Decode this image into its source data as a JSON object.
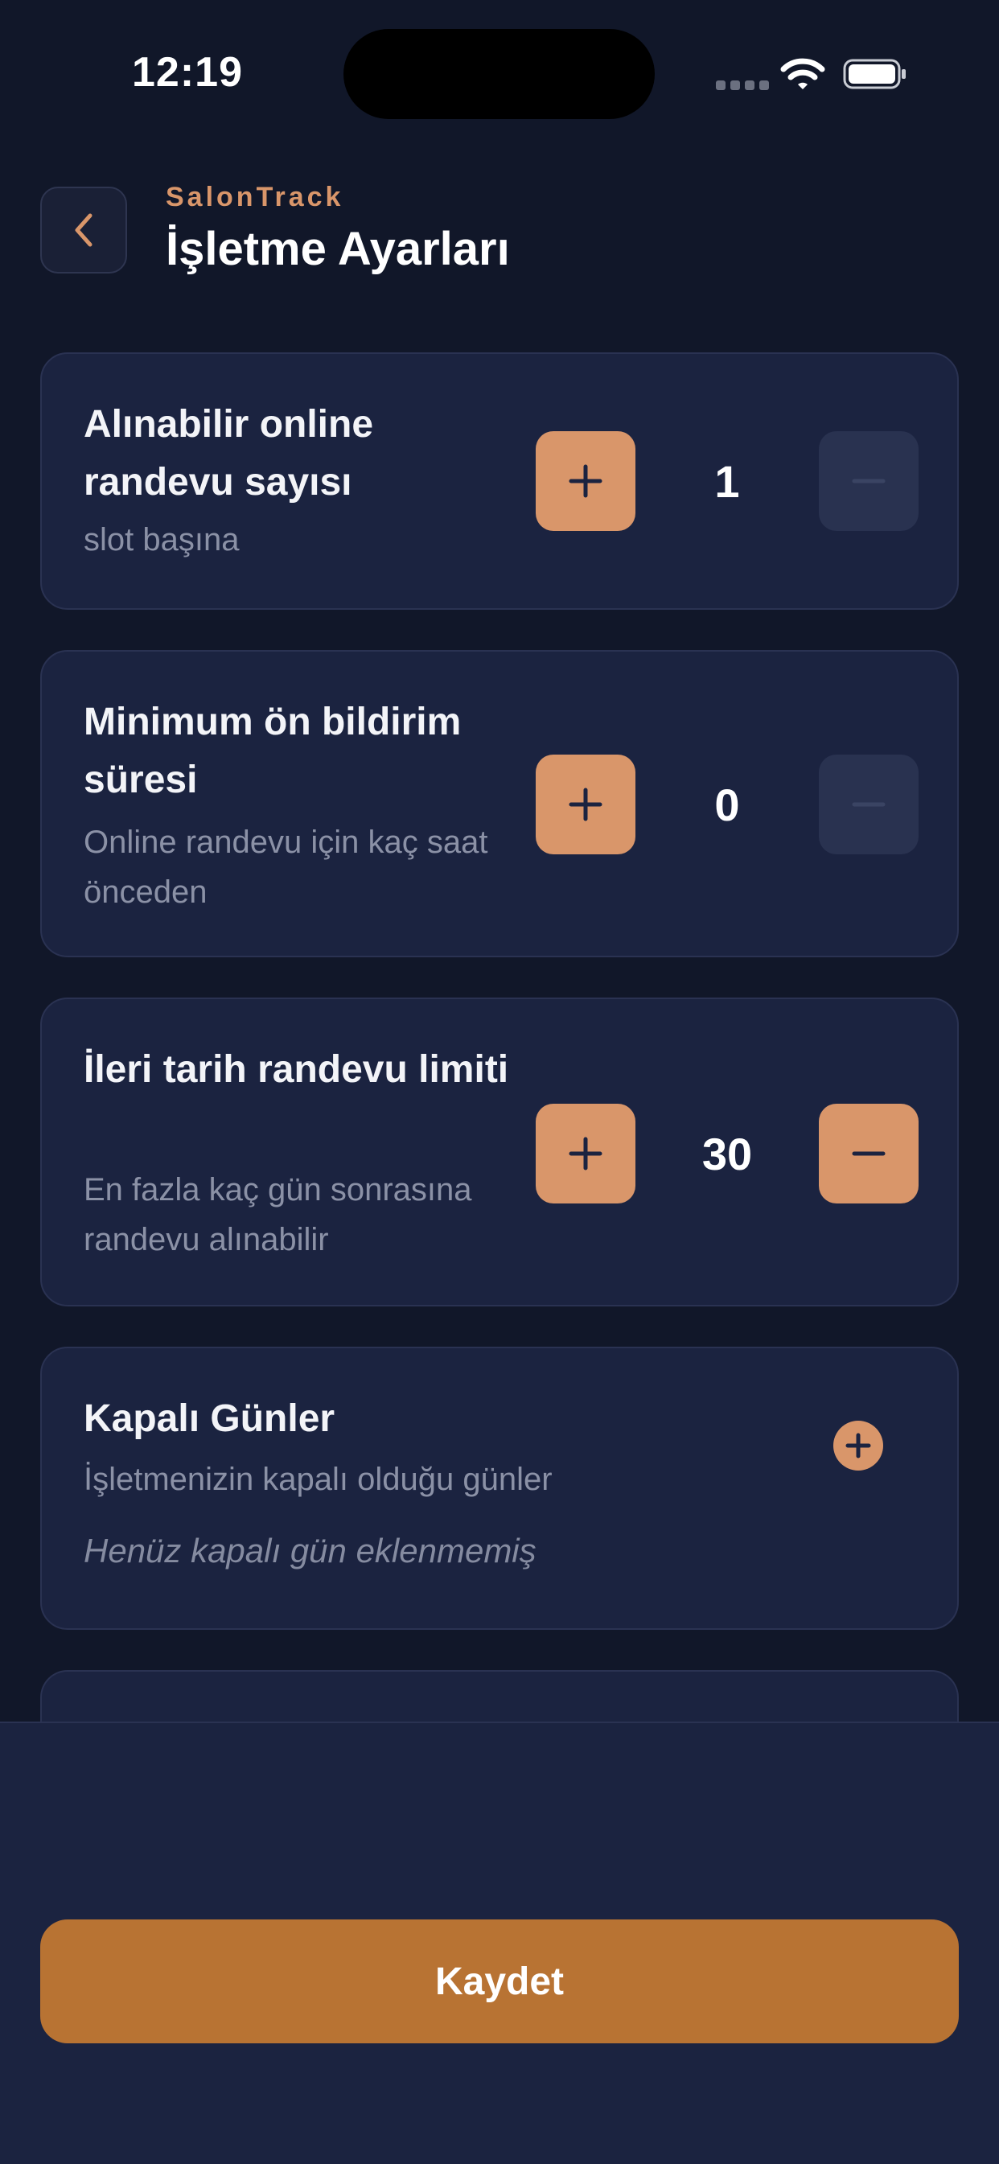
{
  "status_bar": {
    "time": "12:19"
  },
  "header": {
    "brand": "SalonTrack",
    "title": "İşletme Ayarları"
  },
  "settings": [
    {
      "title": "Alınabilir online randevu sayısı",
      "subtitle": "slot başına",
      "value": "1"
    },
    {
      "title": "Minimum ön bildirim süresi",
      "subtitle": "Online randevu için kaç saat önceden",
      "value": "0"
    },
    {
      "title": "İleri tarih randevu limiti",
      "subtitle": "En fazla kaç gün sonrasına randevu alınabilir",
      "value": "30"
    }
  ],
  "closed_days": {
    "title": "Kapalı Günler",
    "subtitle": "İşletmenizin kapalı olduğu günler",
    "empty_text": "Henüz kapalı gün eklenmemiş"
  },
  "footer": {
    "save_label": "Kaydet"
  },
  "colors": {
    "background": "#111729",
    "card": "#1b2340",
    "accent": "#d9966a",
    "save_button": "#b87333",
    "disabled": "#293250"
  }
}
